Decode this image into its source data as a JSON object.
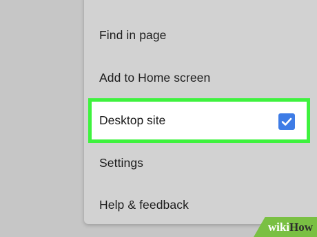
{
  "menu": {
    "items": [
      {
        "label": "Find in page"
      },
      {
        "label": "Add to Home screen"
      },
      {
        "label": "Desktop site",
        "checked": true
      },
      {
        "label": "Settings"
      },
      {
        "label": "Help & feedback"
      }
    ]
  },
  "colors": {
    "highlight_border": "#3ef23e",
    "checkbox": "#3e7ce6",
    "menu_background": "#d2d2d2",
    "page_background": "#c6c6c6"
  },
  "icons": {
    "checkbox": "check-icon"
  },
  "watermark": {
    "part1": "wiki",
    "part2": "How"
  }
}
